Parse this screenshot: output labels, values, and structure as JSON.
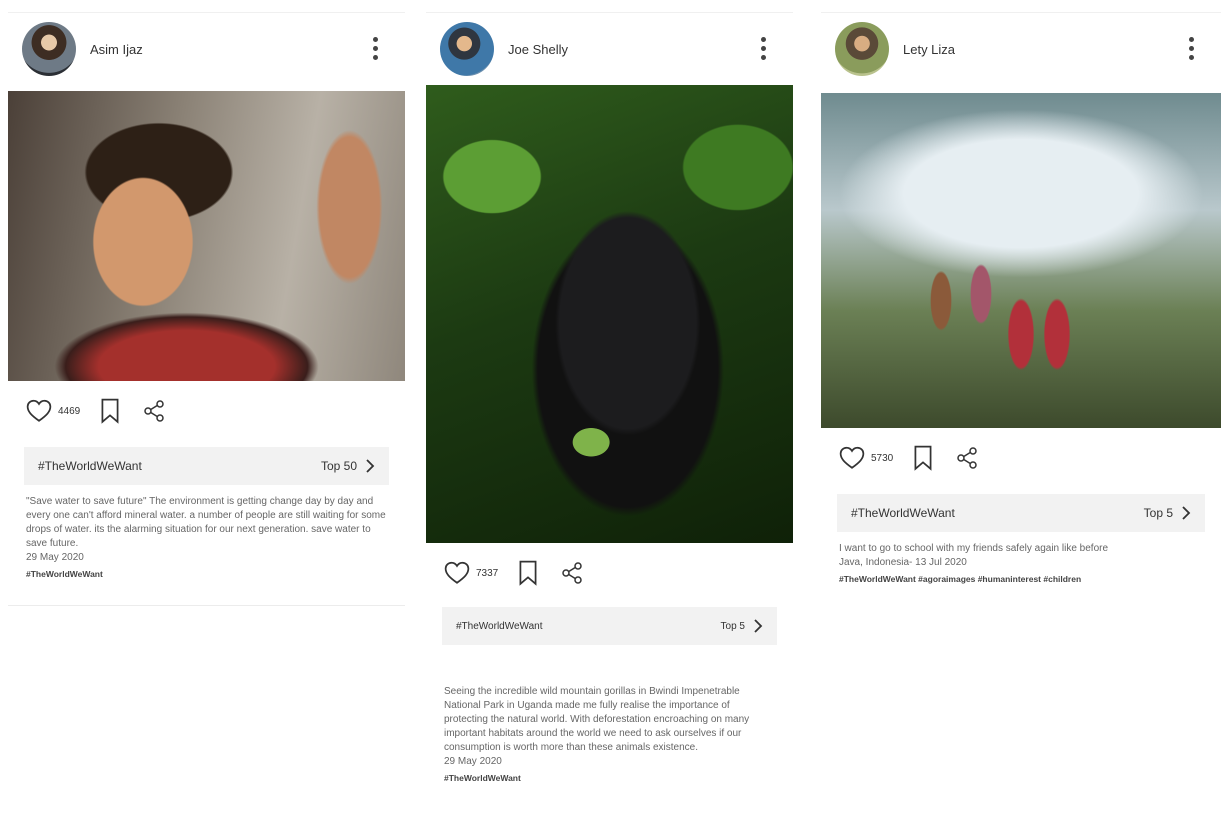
{
  "posts": [
    {
      "user": "Asim Ijaz",
      "likes": "4469",
      "tag": "#TheWorldWeWant",
      "rank": "Top 50",
      "caption": "\"Save water to save future\" The environment is getting change day by day and every one can't afford mineral water. a number of people are still waiting for some drops of water. its the alarming situation for our next generation. save water to save future.",
      "date": "29 May 2020",
      "hashtags": "#TheWorldWeWant"
    },
    {
      "user": "Joe Shelly",
      "likes": "7337",
      "tag": "#TheWorldWeWant",
      "rank": "Top 5",
      "caption": "Seeing the incredible wild mountain gorillas in Bwindi Impenetrable National Park in Uganda made me fully realise the importance of protecting the natural world. With deforestation encroaching on many important habitats around the world we need to ask ourselves if our consumption is worth more than these animals existence.",
      "date": "29 May 2020",
      "hashtags": "#TheWorldWeWant"
    },
    {
      "user": "Lety Liza",
      "likes": "5730",
      "tag": "#TheWorldWeWant",
      "rank": "Top 5",
      "caption": "I want to go to school with my friends safely again like before",
      "date": "Java, Indonesia- 13 Jul 2020",
      "hashtags": "#TheWorldWeWant  #agoraimages  #humaninterest  #children"
    }
  ],
  "icons": {
    "like": "heart-icon",
    "save": "bookmark-icon",
    "share": "share-icon",
    "menu": "more-vertical-icon",
    "next": "chevron-right-icon"
  }
}
